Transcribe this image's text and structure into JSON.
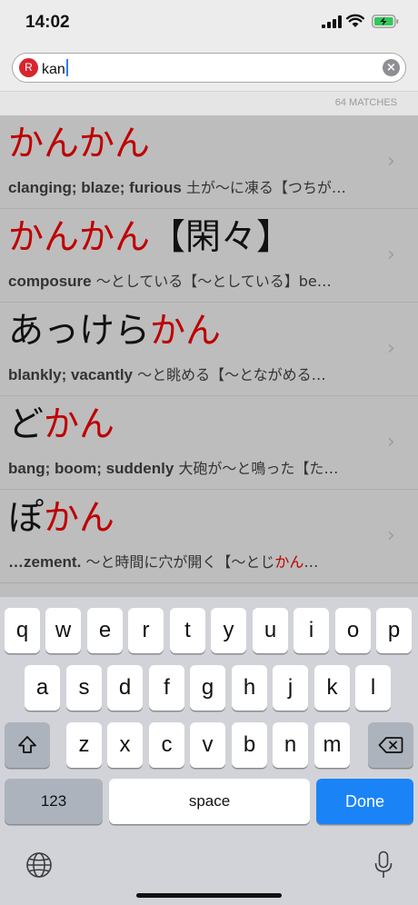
{
  "status_bar": {
    "time": "14:02",
    "icons": [
      "cellular-signal-icon",
      "wifi-icon",
      "battery-charging-icon"
    ],
    "battery_color": "#34c759"
  },
  "search": {
    "badge": "R",
    "query": "kan",
    "clear_icon": "clear-icon"
  },
  "matches": "64 MATCHES",
  "colors": {
    "highlight": "#bf0000",
    "done_key": "#1a84f7"
  },
  "results": [
    {
      "head_pre": "",
      "head_hl": "かんかん",
      "head_post": "",
      "def_en": "clanging; blaze; furious",
      "def_jp": " 土が〜に凍る【つちが…",
      "def_hl": "",
      "def_tail": ""
    },
    {
      "head_pre": "",
      "head_hl": "かんかん",
      "head_post": "【閑々】",
      "def_en": "composure",
      "def_jp": " 〜としている【〜としている】be…",
      "def_hl": "",
      "def_tail": ""
    },
    {
      "head_pre": "あっけら",
      "head_hl": "かん",
      "head_post": "",
      "def_en": "blankly; vacantly",
      "def_jp": " 〜と眺める【〜とながめる…",
      "def_hl": "",
      "def_tail": ""
    },
    {
      "head_pre": "ど",
      "head_hl": "かん",
      "head_post": "",
      "def_en": "bang; boom; suddenly",
      "def_jp": " 大砲が〜と鳴った【た…",
      "def_hl": "",
      "def_tail": ""
    },
    {
      "head_pre": "ぽ",
      "head_hl": "かん",
      "head_post": "",
      "def_en": "…zement.",
      "def_jp": " 〜と時間に穴が開く【〜とじ",
      "def_hl": "かん",
      "def_tail": "…"
    }
  ],
  "keyboard": {
    "row1": [
      "q",
      "w",
      "e",
      "r",
      "t",
      "y",
      "u",
      "i",
      "o",
      "p"
    ],
    "row2": [
      "a",
      "s",
      "d",
      "f",
      "g",
      "h",
      "j",
      "k",
      "l"
    ],
    "row3": [
      "z",
      "x",
      "c",
      "v",
      "b",
      "n",
      "m"
    ],
    "numbers_key": "123",
    "space_key": "space",
    "done_key": "Done",
    "icons": [
      "shift-icon",
      "backspace-icon",
      "globe-icon",
      "microphone-icon"
    ]
  }
}
